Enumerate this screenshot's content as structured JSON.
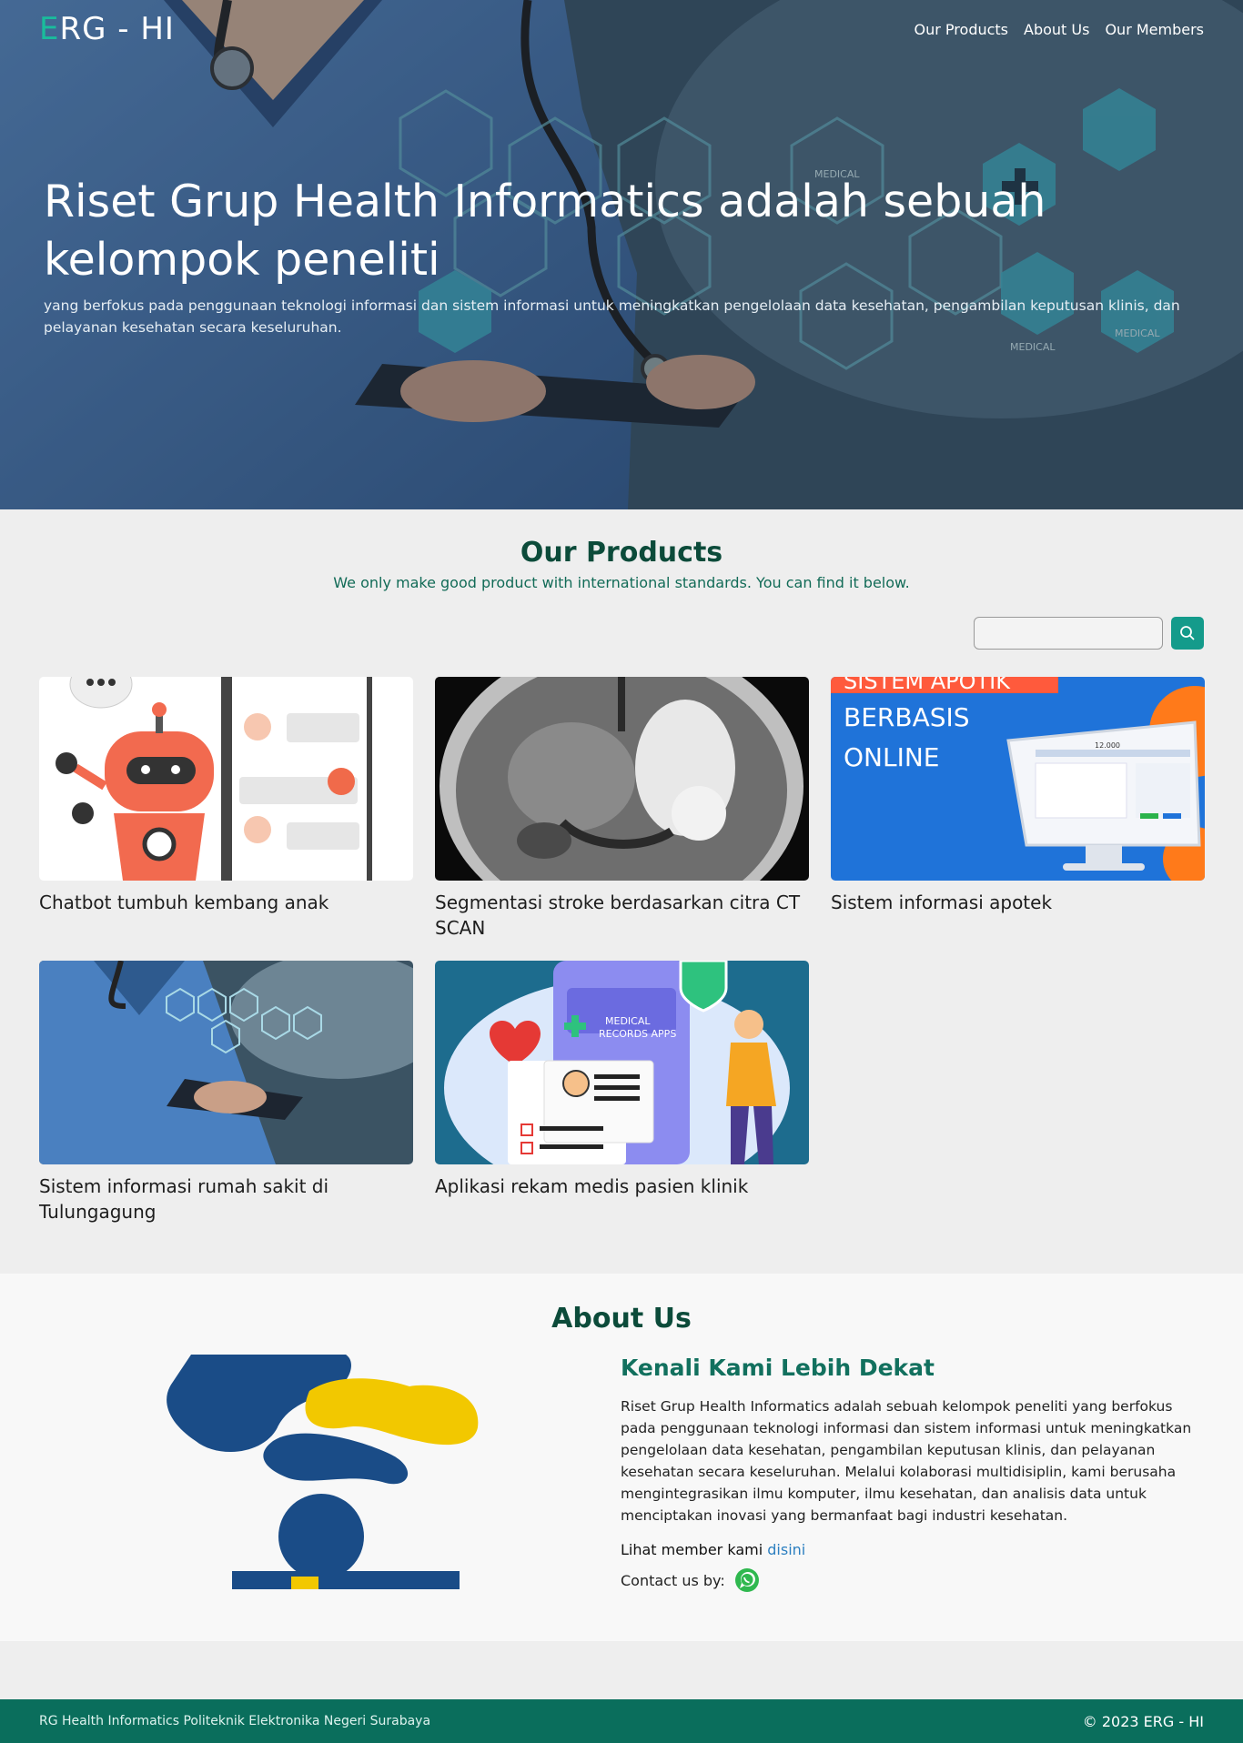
{
  "nav": {
    "brand_first": "E",
    "brand_rest": "RG - HI",
    "links": [
      "Our Products",
      "About Us",
      "Our Members"
    ]
  },
  "hero": {
    "title": "Riset Grup Health Informatics adalah sebuah kelompok peneliti",
    "subtitle": "yang berfokus pada penggunaan teknologi informasi dan sistem informasi untuk meningkatkan pengelolaan data kesehatan, pengambilan keputusan klinis, dan pelayanan kesehatan secara keseluruhan.",
    "image_labels": [
      "MEDICAL",
      "MEDICAL",
      "MEDICAL"
    ]
  },
  "products": {
    "title": "Our Products",
    "subtitle": "We only make good product with international standards. You can find it below.",
    "search_value": "",
    "items": [
      {
        "title": "Chatbot tumbuh kembang anak"
      },
      {
        "title": "Segmentasi stroke berdasarkan citra CT SCAN"
      },
      {
        "title": "Sistem informasi apotek",
        "image_text": [
          "SISTEM APOTIK",
          "BERBASIS",
          "ONLINE"
        ],
        "screen_value": "12.000"
      },
      {
        "title": "Sistem informasi rumah sakit di Tulungagung"
      },
      {
        "title": "Aplikasi rekam medis pasien klinik",
        "image_text": [
          "MEDICAL",
          "RECORDS APPS"
        ]
      }
    ]
  },
  "about": {
    "title": "About Us",
    "heading": "Kenali Kami Lebih Dekat",
    "paragraph": "Riset Grup Health Informatics adalah sebuah kelompok peneliti yang berfokus pada penggunaan teknologi informasi dan sistem informasi untuk meningkatkan pengelolaan data kesehatan, pengambilan keputusan klinis, dan pelayanan kesehatan secara keseluruhan. Melalui kolaborasi multidisiplin, kami berusaha mengintegrasikan ilmu komputer, ilmu kesehatan, dan analisis data untuk menciptakan inovasi yang bermanfaat bagi industri kesehatan.",
    "member_prefix": "Lihat member kami",
    "member_link": "disini",
    "contact_label": "Contact us by:"
  },
  "footer": {
    "left": "RG Health Informatics Politeknik Elektronika Negeri Surabaya",
    "right": "© 2023 ERG - HI"
  },
  "colors": {
    "accent": "#149b8b",
    "title_green": "#0c4b3a",
    "footer": "#0a6e5c",
    "logo_blue": "#1a4c87",
    "logo_yellow": "#f2c800"
  }
}
